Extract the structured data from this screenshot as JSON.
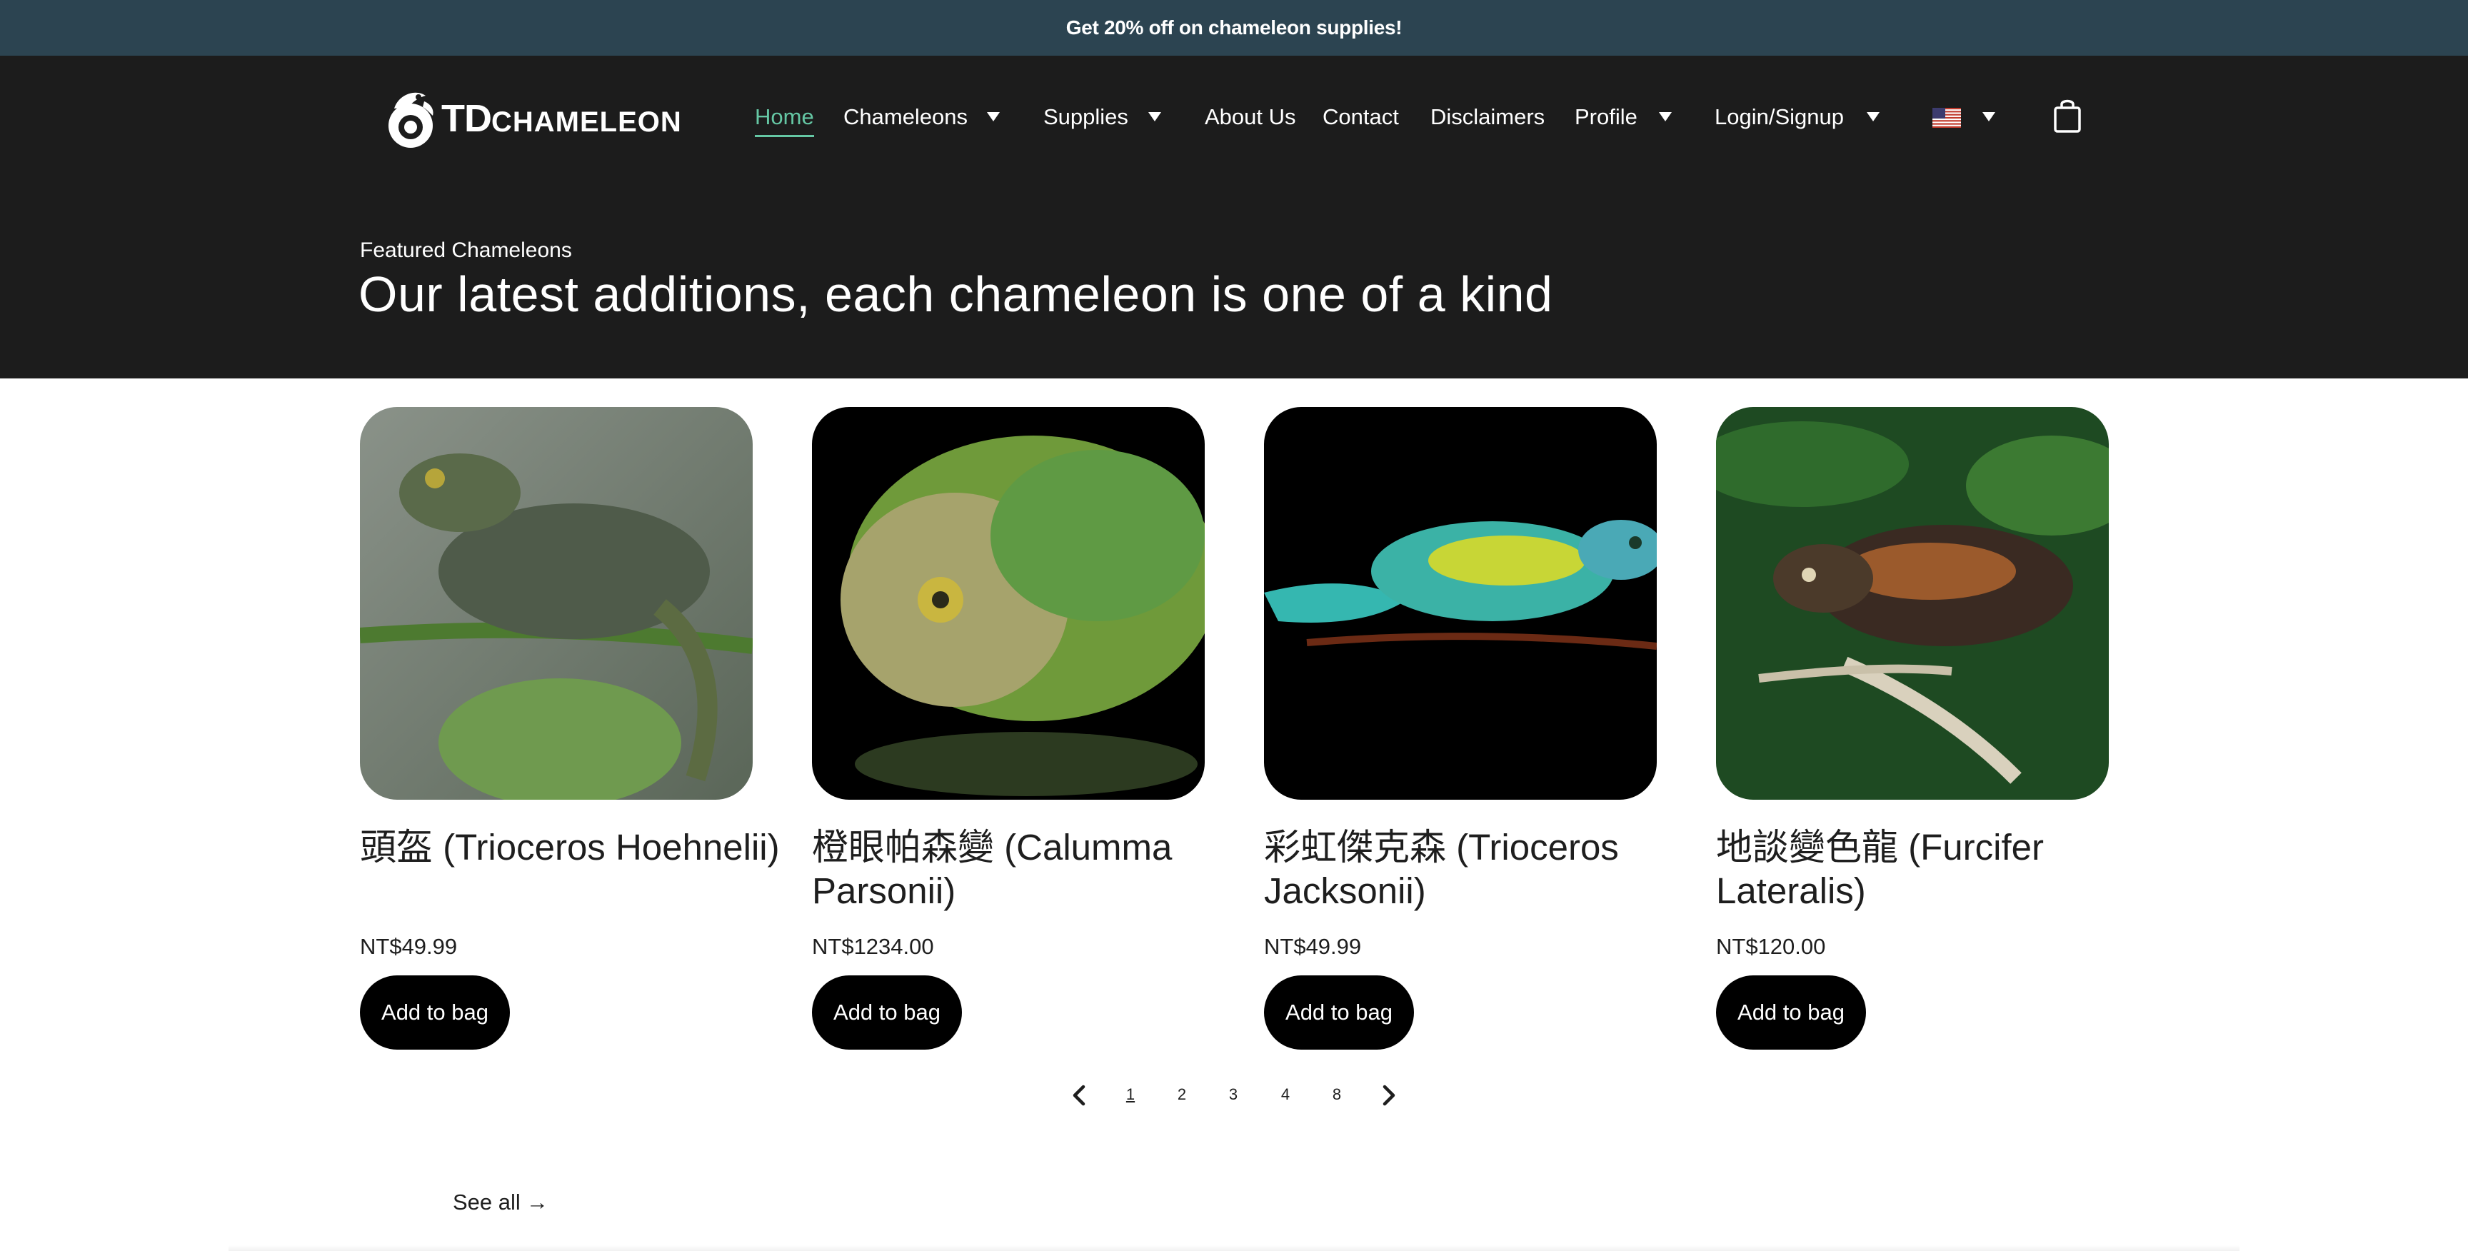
{
  "promo": {
    "text": "Get 20% off on chameleon supplies!"
  },
  "logo": {
    "td": "TD",
    "rest": "CHAMELEON"
  },
  "nav": {
    "items": [
      {
        "label": "Home"
      },
      {
        "label": "Chameleons"
      },
      {
        "label": "Supplies"
      },
      {
        "label": "About Us"
      },
      {
        "label": "Contact"
      },
      {
        "label": "Disclaimers"
      },
      {
        "label": "Profile"
      },
      {
        "label": "Login/Signup"
      }
    ],
    "language_flag": "us-flag-icon",
    "bag_icon": "shopping-bag-icon",
    "accent_color": "#65c7a4"
  },
  "hero": {
    "eyebrow": "Featured Chameleons",
    "title": "Our latest additions, each chameleon is one of a kind"
  },
  "products": [
    {
      "name": "頭盔 (Trioceros Hoehnelii)",
      "price": "NT$49.99",
      "button": "Add to bag"
    },
    {
      "name": "橙眼帕森變 (Calumma Parsonii)",
      "price": "NT$1234.00",
      "button": "Add to bag"
    },
    {
      "name": "彩虹傑克森 (Trioceros Jacksonii)",
      "price": "NT$49.99",
      "button": "Add to bag"
    },
    {
      "name": "地談變色龍 (Furcifer Lateralis)",
      "price": "NT$120.00",
      "button": "Add to bag"
    }
  ],
  "pagination": {
    "pages": [
      "1",
      "2",
      "3",
      "4",
      "8"
    ],
    "current": "1"
  },
  "see_all": {
    "label": "See all",
    "arrow": "→"
  },
  "colors": {
    "promo_bg": "#2c4451",
    "nav_bg": "#1c1c1c",
    "button_bg": "#000000"
  }
}
